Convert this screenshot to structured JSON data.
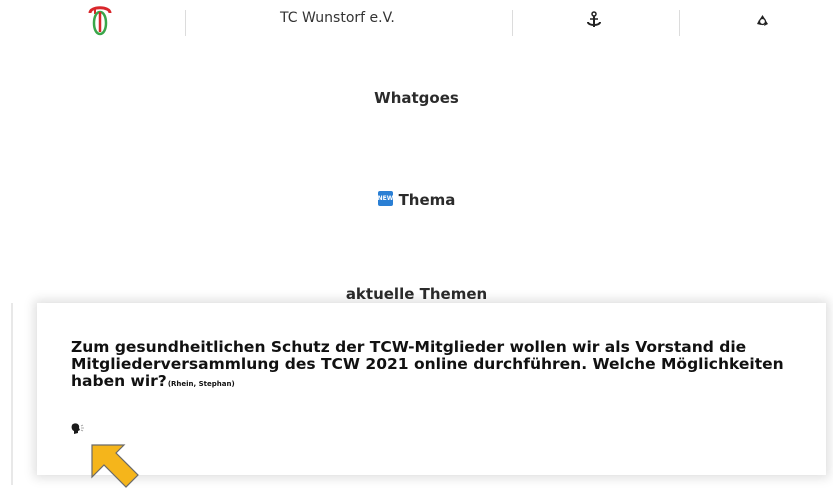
{
  "header": {
    "site_title": "TC Wunstorf e.V."
  },
  "main": {
    "heading_whatgoes": "Whatgoes",
    "thema_label": "Thema",
    "new_badge": "NEW",
    "aktuelle_themen": "aktuelle Themen"
  },
  "card": {
    "question": "Zum gesundheitlichen Schutz der TCW-Mitglieder wollen wir als Vorstand die Mitgliederversammlung des TCW 2021 online durchführen. Welche Möglichkeiten haben wir?",
    "author": "(Rhein, Stephan)"
  },
  "icons": {
    "logo": "tcw-logo-icon",
    "anchor": "anchor-icon",
    "recycle": "recycle-icon",
    "speak": "speaking-head-icon",
    "cursor": "pointer-arrow-icon"
  },
  "colors": {
    "logo_red": "#d9262b",
    "logo_green": "#3aa64a",
    "badge_blue": "#2a7fd4",
    "cursor_yellow": "#f5b51b"
  }
}
